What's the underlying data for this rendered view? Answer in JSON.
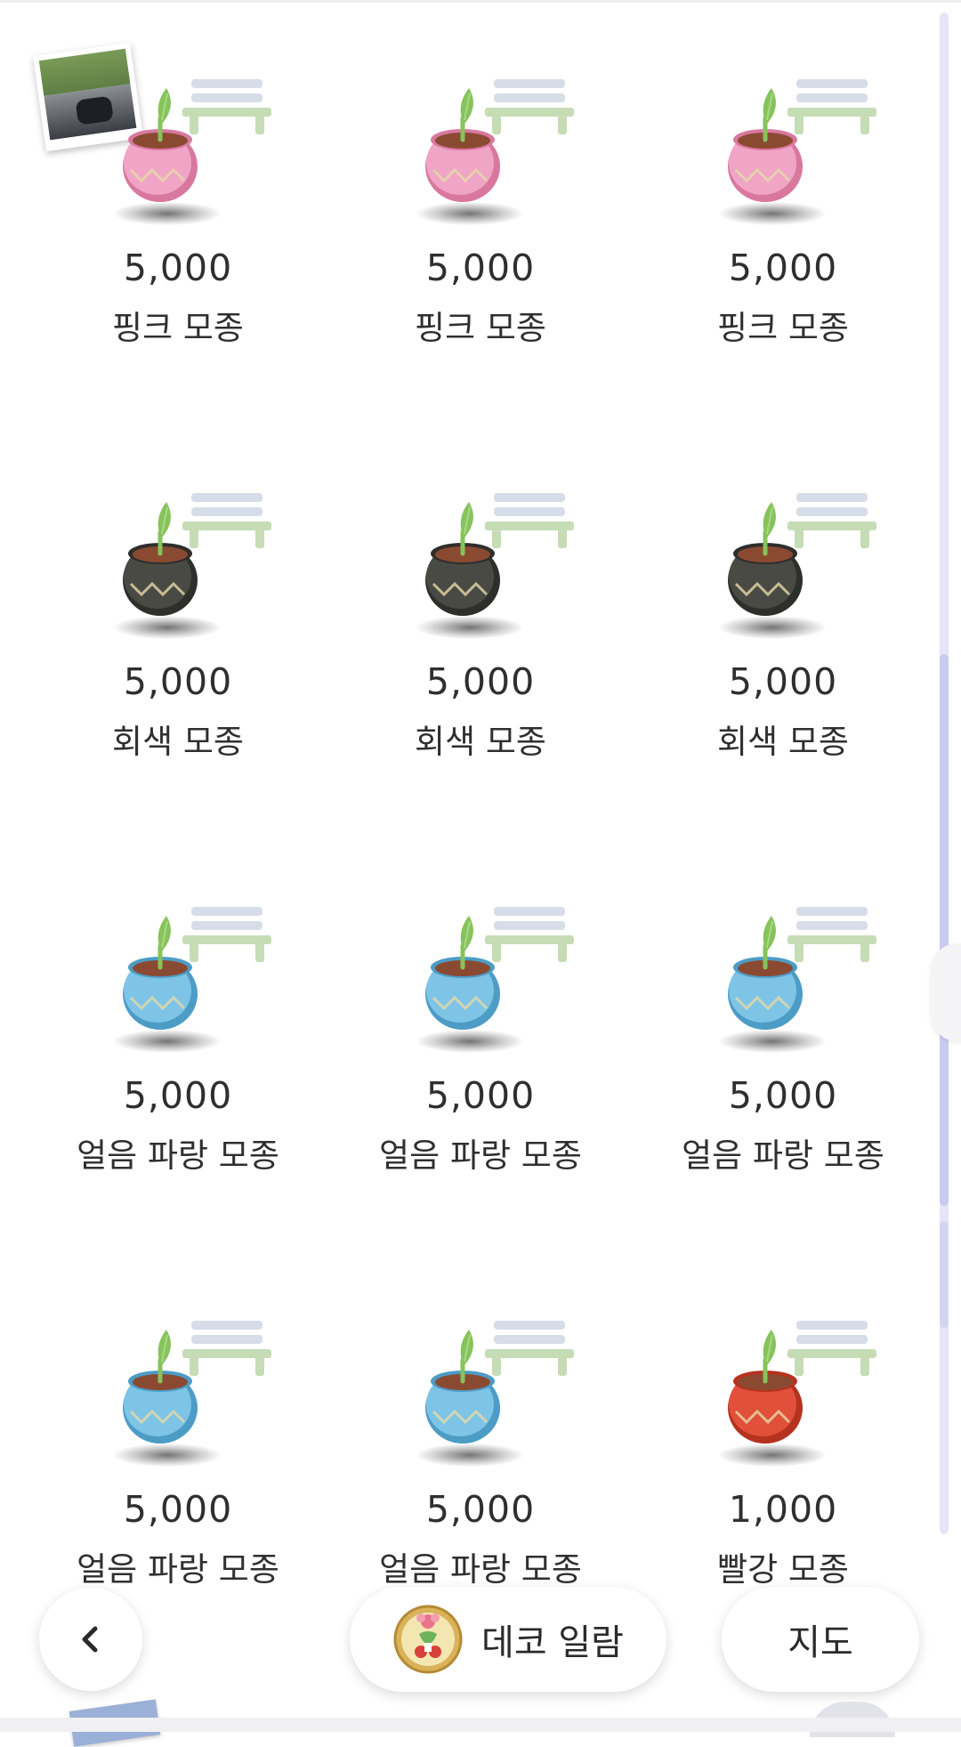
{
  "items": [
    {
      "price": "5,000",
      "name": "핑크 모종",
      "pot_color": "#f0a5c6",
      "pot_dark": "#d9789f",
      "has_photo": true
    },
    {
      "price": "5,000",
      "name": "핑크 모종",
      "pot_color": "#f0a5c6",
      "pot_dark": "#d9789f",
      "has_photo": false
    },
    {
      "price": "5,000",
      "name": "핑크 모종",
      "pot_color": "#f0a5c6",
      "pot_dark": "#d9789f",
      "has_photo": false
    },
    {
      "price": "5,000",
      "name": "회색 모종",
      "pot_color": "#4a4a45",
      "pot_dark": "#2e2e2b",
      "has_photo": false
    },
    {
      "price": "5,000",
      "name": "회색 모종",
      "pot_color": "#4a4a45",
      "pot_dark": "#2e2e2b",
      "has_photo": false
    },
    {
      "price": "5,000",
      "name": "회색 모종",
      "pot_color": "#4a4a45",
      "pot_dark": "#2e2e2b",
      "has_photo": false
    },
    {
      "price": "5,000",
      "name": "얼음 파랑 모종",
      "pot_color": "#7ec4e6",
      "pot_dark": "#4d9cc6",
      "has_photo": false
    },
    {
      "price": "5,000",
      "name": "얼음 파랑 모종",
      "pot_color": "#7ec4e6",
      "pot_dark": "#4d9cc6",
      "has_photo": false
    },
    {
      "price": "5,000",
      "name": "얼음 파랑 모종",
      "pot_color": "#7ec4e6",
      "pot_dark": "#4d9cc6",
      "has_photo": false
    },
    {
      "price": "5,000",
      "name": "얼음 파랑 모종",
      "pot_color": "#7ec4e6",
      "pot_dark": "#4d9cc6",
      "has_photo": false
    },
    {
      "price": "5,000",
      "name": "얼음 파랑 모종",
      "pot_color": "#7ec4e6",
      "pot_dark": "#4d9cc6",
      "has_photo": false
    },
    {
      "price": "1,000",
      "name": "빨강 모종",
      "pot_color": "#e1503a",
      "pot_dark": "#b5321f",
      "has_photo": false
    }
  ],
  "nav": {
    "back_icon": "chevron-left-icon",
    "deco_label": "데코 일람",
    "deco_icon": "medal-icon",
    "map_label": "지도"
  },
  "colors": {
    "sprout": "#86c35a",
    "soil": "#8a4a32",
    "bench_top": "#d6dde8",
    "bench_legs": "#c5dcb5",
    "scroll_thumb": "#c9cbef"
  }
}
